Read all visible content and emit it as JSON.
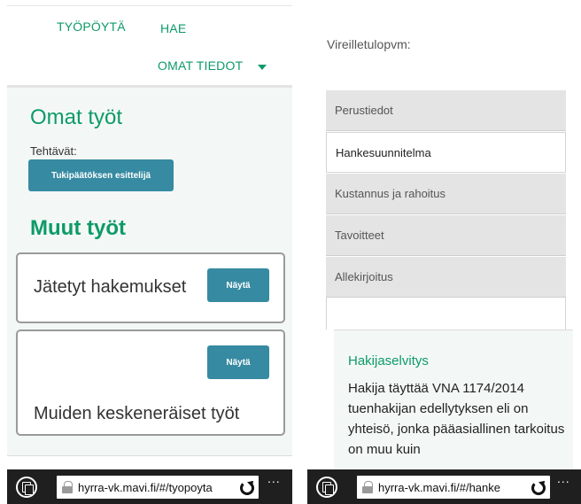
{
  "left": {
    "nav": {
      "work": "TYÖPÖYTÄ",
      "search": "HAE",
      "own": "OMAT TIEDOT"
    },
    "own_heading": "Omat työt",
    "tasks_label": "Tehtävät:",
    "task_button": "Tukipäätöksen esittelijä",
    "other_heading": "Muut työt",
    "cards": [
      {
        "title": "Jätetyt hakemukset",
        "button": "Näytä"
      },
      {
        "title": "Muiden keskeneräiset työt",
        "button": "Näytä"
      }
    ],
    "browser": {
      "url": "hyrra-vk.mavi.fi/#/tyopoyta",
      "more": "..."
    }
  },
  "right": {
    "date_label": "Vireilletulopvm:",
    "tabs": [
      {
        "label": "Perustiedot",
        "active": false
      },
      {
        "label": "Hankesuunnitelma",
        "active": true
      },
      {
        "label": "Kustannus ja rahoitus",
        "active": false
      },
      {
        "label": "Tavoitteet",
        "active": false
      },
      {
        "label": "Allekirjoitus",
        "active": false
      }
    ],
    "panel": {
      "title": "Hakijaselvitys",
      "body": "Hakija täyttää VNA 1174/2014 tuenhakijan edellytyksen eli on yhteisö, jonka pääasiallinen tarkoitus on muu kuin"
    },
    "browser": {
      "url": "hyrra-vk.mavi.fi/#/hanke",
      "more": "..."
    }
  },
  "colors": {
    "brand_green": "#0e9a68",
    "button_teal": "#368aa1",
    "browser_bar": "#1f1f1f"
  }
}
